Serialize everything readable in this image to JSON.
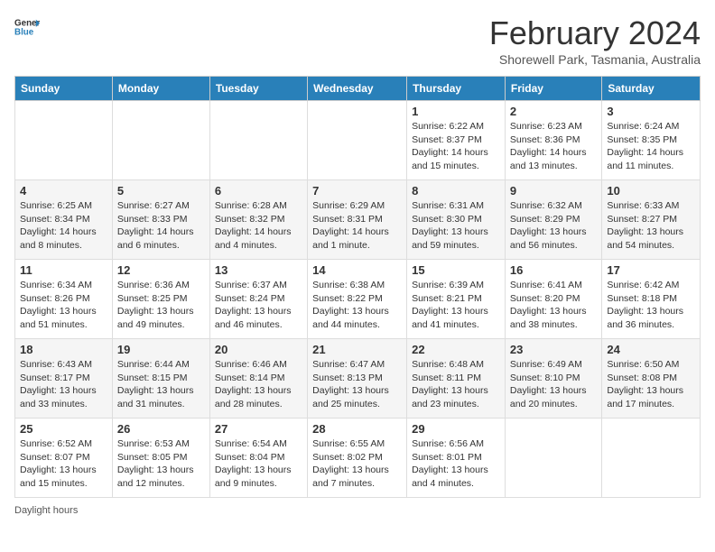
{
  "header": {
    "logo_line1": "General",
    "logo_line2": "Blue",
    "month": "February 2024",
    "location": "Shorewell Park, Tasmania, Australia"
  },
  "days_of_week": [
    "Sunday",
    "Monday",
    "Tuesday",
    "Wednesday",
    "Thursday",
    "Friday",
    "Saturday"
  ],
  "weeks": [
    [
      {
        "num": "",
        "sunrise": "",
        "sunset": "",
        "daylight": ""
      },
      {
        "num": "",
        "sunrise": "",
        "sunset": "",
        "daylight": ""
      },
      {
        "num": "",
        "sunrise": "",
        "sunset": "",
        "daylight": ""
      },
      {
        "num": "",
        "sunrise": "",
        "sunset": "",
        "daylight": ""
      },
      {
        "num": "1",
        "sunrise": "Sunrise: 6:22 AM",
        "sunset": "Sunset: 8:37 PM",
        "daylight": "Daylight: 14 hours and 15 minutes."
      },
      {
        "num": "2",
        "sunrise": "Sunrise: 6:23 AM",
        "sunset": "Sunset: 8:36 PM",
        "daylight": "Daylight: 14 hours and 13 minutes."
      },
      {
        "num": "3",
        "sunrise": "Sunrise: 6:24 AM",
        "sunset": "Sunset: 8:35 PM",
        "daylight": "Daylight: 14 hours and 11 minutes."
      }
    ],
    [
      {
        "num": "4",
        "sunrise": "Sunrise: 6:25 AM",
        "sunset": "Sunset: 8:34 PM",
        "daylight": "Daylight: 14 hours and 8 minutes."
      },
      {
        "num": "5",
        "sunrise": "Sunrise: 6:27 AM",
        "sunset": "Sunset: 8:33 PM",
        "daylight": "Daylight: 14 hours and 6 minutes."
      },
      {
        "num": "6",
        "sunrise": "Sunrise: 6:28 AM",
        "sunset": "Sunset: 8:32 PM",
        "daylight": "Daylight: 14 hours and 4 minutes."
      },
      {
        "num": "7",
        "sunrise": "Sunrise: 6:29 AM",
        "sunset": "Sunset: 8:31 PM",
        "daylight": "Daylight: 14 hours and 1 minute."
      },
      {
        "num": "8",
        "sunrise": "Sunrise: 6:31 AM",
        "sunset": "Sunset: 8:30 PM",
        "daylight": "Daylight: 13 hours and 59 minutes."
      },
      {
        "num": "9",
        "sunrise": "Sunrise: 6:32 AM",
        "sunset": "Sunset: 8:29 PM",
        "daylight": "Daylight: 13 hours and 56 minutes."
      },
      {
        "num": "10",
        "sunrise": "Sunrise: 6:33 AM",
        "sunset": "Sunset: 8:27 PM",
        "daylight": "Daylight: 13 hours and 54 minutes."
      }
    ],
    [
      {
        "num": "11",
        "sunrise": "Sunrise: 6:34 AM",
        "sunset": "Sunset: 8:26 PM",
        "daylight": "Daylight: 13 hours and 51 minutes."
      },
      {
        "num": "12",
        "sunrise": "Sunrise: 6:36 AM",
        "sunset": "Sunset: 8:25 PM",
        "daylight": "Daylight: 13 hours and 49 minutes."
      },
      {
        "num": "13",
        "sunrise": "Sunrise: 6:37 AM",
        "sunset": "Sunset: 8:24 PM",
        "daylight": "Daylight: 13 hours and 46 minutes."
      },
      {
        "num": "14",
        "sunrise": "Sunrise: 6:38 AM",
        "sunset": "Sunset: 8:22 PM",
        "daylight": "Daylight: 13 hours and 44 minutes."
      },
      {
        "num": "15",
        "sunrise": "Sunrise: 6:39 AM",
        "sunset": "Sunset: 8:21 PM",
        "daylight": "Daylight: 13 hours and 41 minutes."
      },
      {
        "num": "16",
        "sunrise": "Sunrise: 6:41 AM",
        "sunset": "Sunset: 8:20 PM",
        "daylight": "Daylight: 13 hours and 38 minutes."
      },
      {
        "num": "17",
        "sunrise": "Sunrise: 6:42 AM",
        "sunset": "Sunset: 8:18 PM",
        "daylight": "Daylight: 13 hours and 36 minutes."
      }
    ],
    [
      {
        "num": "18",
        "sunrise": "Sunrise: 6:43 AM",
        "sunset": "Sunset: 8:17 PM",
        "daylight": "Daylight: 13 hours and 33 minutes."
      },
      {
        "num": "19",
        "sunrise": "Sunrise: 6:44 AM",
        "sunset": "Sunset: 8:15 PM",
        "daylight": "Daylight: 13 hours and 31 minutes."
      },
      {
        "num": "20",
        "sunrise": "Sunrise: 6:46 AM",
        "sunset": "Sunset: 8:14 PM",
        "daylight": "Daylight: 13 hours and 28 minutes."
      },
      {
        "num": "21",
        "sunrise": "Sunrise: 6:47 AM",
        "sunset": "Sunset: 8:13 PM",
        "daylight": "Daylight: 13 hours and 25 minutes."
      },
      {
        "num": "22",
        "sunrise": "Sunrise: 6:48 AM",
        "sunset": "Sunset: 8:11 PM",
        "daylight": "Daylight: 13 hours and 23 minutes."
      },
      {
        "num": "23",
        "sunrise": "Sunrise: 6:49 AM",
        "sunset": "Sunset: 8:10 PM",
        "daylight": "Daylight: 13 hours and 20 minutes."
      },
      {
        "num": "24",
        "sunrise": "Sunrise: 6:50 AM",
        "sunset": "Sunset: 8:08 PM",
        "daylight": "Daylight: 13 hours and 17 minutes."
      }
    ],
    [
      {
        "num": "25",
        "sunrise": "Sunrise: 6:52 AM",
        "sunset": "Sunset: 8:07 PM",
        "daylight": "Daylight: 13 hours and 15 minutes."
      },
      {
        "num": "26",
        "sunrise": "Sunrise: 6:53 AM",
        "sunset": "Sunset: 8:05 PM",
        "daylight": "Daylight: 13 hours and 12 minutes."
      },
      {
        "num": "27",
        "sunrise": "Sunrise: 6:54 AM",
        "sunset": "Sunset: 8:04 PM",
        "daylight": "Daylight: 13 hours and 9 minutes."
      },
      {
        "num": "28",
        "sunrise": "Sunrise: 6:55 AM",
        "sunset": "Sunset: 8:02 PM",
        "daylight": "Daylight: 13 hours and 7 minutes."
      },
      {
        "num": "29",
        "sunrise": "Sunrise: 6:56 AM",
        "sunset": "Sunset: 8:01 PM",
        "daylight": "Daylight: 13 hours and 4 minutes."
      },
      {
        "num": "",
        "sunrise": "",
        "sunset": "",
        "daylight": ""
      },
      {
        "num": "",
        "sunrise": "",
        "sunset": "",
        "daylight": ""
      }
    ]
  ],
  "legend": {
    "daylight_hours_label": "Daylight hours"
  }
}
